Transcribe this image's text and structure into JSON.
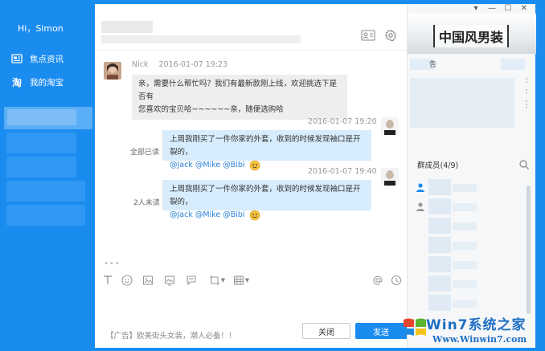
{
  "sidebar": {
    "greeting": "Hi，Simon",
    "items": [
      {
        "label": "焦点资讯",
        "icon": "news-icon"
      },
      {
        "label": "我的淘宝",
        "icon": "taobao-icon",
        "glyph": "淘"
      }
    ]
  },
  "header": {
    "contact_card_icon": "contact-card-icon",
    "settings_icon": "gear-icon"
  },
  "messages": [
    {
      "sender": "Nick",
      "time": "2016-01-07  19:23",
      "text_line1": "亲，需要什么帮忙吗？我们有最新款刚上线，欢迎挑选下是否有",
      "text_line2": "您喜欢的宝贝哈~~~~~~亲，随便选购哈"
    },
    {
      "time": "2016-01-07  19:20",
      "text_line1": "上周我刚买了一件你家的外套，收到的时候发现袖口是开裂的，",
      "mentions": "@Jack @Mike @Bibi",
      "status": "全部已读"
    },
    {
      "time": "2016-01-07  19:40",
      "text_line1": "上周我刚买了一件你家的外套，收到的时候发现袖口是开裂的，",
      "mentions": "@Jack @Mike @Bibi",
      "status": "2人未读"
    }
  ],
  "typing_dots": "•••",
  "toolbar": {
    "icons": [
      "text-format-icon",
      "emoji-icon",
      "image-icon",
      "screenshot-icon",
      "chat-bubble-icon",
      "crop-icon",
      "table-icon",
      "at-icon",
      "history-icon"
    ]
  },
  "footer": {
    "ad_text": "【广告】欧美街头女装，潮人必备！！",
    "close_label": "关闭",
    "send_label": "发送"
  },
  "right_panel": {
    "shop_name": "中国风男装",
    "notice_fragment": "告",
    "members_label": "群成员(4/9)"
  },
  "window_controls": [
    "▾",
    "—",
    "☐",
    "✕"
  ],
  "watermark": {
    "line1": "Win7系统之家",
    "line2": "Www.Winwin7.com"
  },
  "colors": {
    "accent": "#1a8cf0",
    "bubble_right": "#d7ecfc",
    "bubble_left": "#eeeeee",
    "mention": "#2a82d8"
  }
}
